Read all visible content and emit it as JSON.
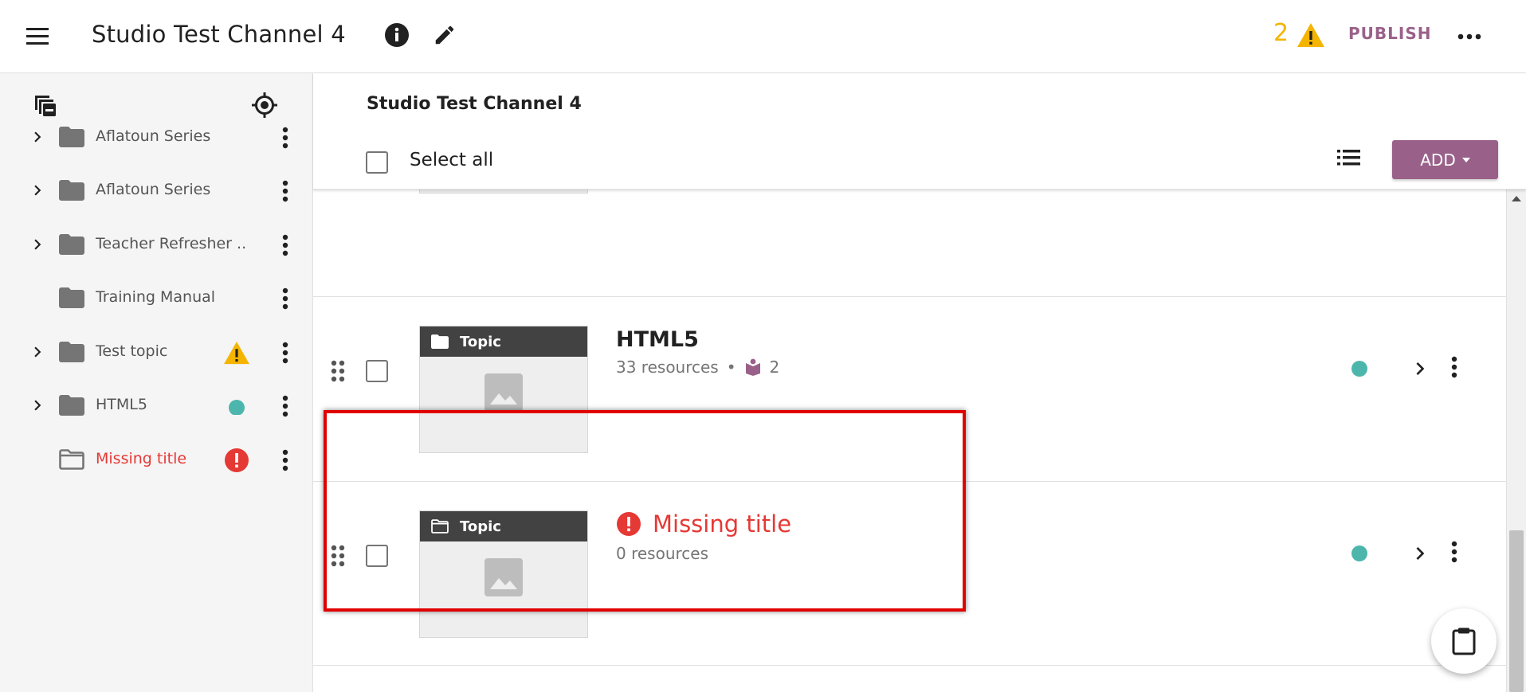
{
  "app": {
    "title": "Studio Test Channel 4",
    "warning_count": "2",
    "publish_label": "PUBLISH"
  },
  "colors": {
    "accent": "#996189",
    "warning": "#f5b400",
    "error": "#e53935",
    "published_dot": "#4db6ac",
    "highlight": "#e00000"
  },
  "sidebar": {
    "items": [
      {
        "label": "Aflatoun Series",
        "expandable": true,
        "status": ""
      },
      {
        "label": "Aflatoun Series",
        "expandable": true,
        "status": ""
      },
      {
        "label": "Teacher Refresher ...",
        "expandable": true,
        "status": ""
      },
      {
        "label": "Training Manual",
        "expandable": false,
        "status": ""
      },
      {
        "label": "Test topic",
        "expandable": true,
        "status": "warning-icon"
      },
      {
        "label": "HTML5",
        "expandable": true,
        "status": "published-dot"
      },
      {
        "label": "Missing title",
        "expandable": false,
        "status": "error-icon"
      }
    ]
  },
  "main": {
    "breadcrumb": "Studio Test Channel 4",
    "select_all_label": "Select all",
    "add_label": "ADD",
    "rows": [
      {
        "kind_label": "Topic",
        "title": "HTML5",
        "resources": "33 resources",
        "separator": "•",
        "learner_count": "2"
      },
      {
        "kind_label": "Topic",
        "title": "Missing title",
        "resources": "0 resources"
      }
    ]
  }
}
